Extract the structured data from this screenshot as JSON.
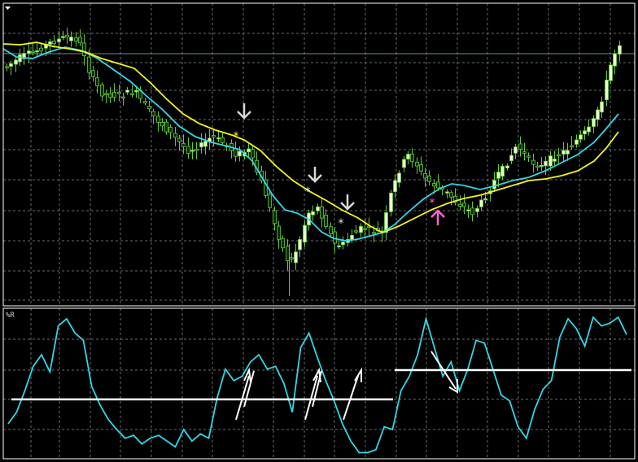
{
  "indicator_label": "%R",
  "colors": {
    "background": "#000000",
    "grid": "#6d6d6d",
    "frame": "#ffffff",
    "bull_candle_body": "#e8ffd0",
    "bear_candle_body": "#0a2a0a",
    "candle_wick": "#66cc33",
    "ma_fast": "#33d6e8",
    "ma_slow": "#f4f41a",
    "wpr_line": "#33d6e8",
    "level_line": "#ffffff",
    "arrow_down": "#d8d8d8",
    "arrow_up": "#ff66cc",
    "signal_star_yellow": "#f4f41a",
    "signal_star_white": "#e0e0e0",
    "signal_star_pink": "#ff66cc"
  },
  "chart_data": [
    {
      "type": "candlestick",
      "title": "",
      "overlays": [
        {
          "kind": "moving-average",
          "color": "#33d6e8"
        },
        {
          "kind": "moving-average",
          "color": "#f4f41a"
        }
      ],
      "signals": [
        {
          "kind": "sell-arrow",
          "bar": 47
        },
        {
          "kind": "sell-arrow",
          "bar": 61
        },
        {
          "kind": "sell-arrow",
          "bar": 68
        },
        {
          "kind": "buy-arrow",
          "bar": 87
        }
      ],
      "grid": true
    },
    {
      "type": "line",
      "title": "%R",
      "series": [
        {
          "values": [
            -78,
            -70,
            -55,
            -38,
            -30,
            -42,
            -10,
            -5,
            -15,
            -20,
            -52,
            -65,
            -75,
            -82,
            -88,
            -86,
            -92,
            -88,
            -86,
            -90,
            -94,
            -82,
            -90,
            -85,
            -88,
            -60,
            -40,
            -48,
            -45,
            -35,
            -30,
            -40,
            -38,
            -50,
            -70,
            -25,
            -15,
            -32,
            -48,
            -62,
            -78,
            -90,
            -98,
            -98,
            -96,
            -80,
            -82,
            -55,
            -45,
            -30,
            -5,
            -25,
            -45,
            -35,
            -55,
            -40,
            -20,
            -22,
            -40,
            -58,
            -62,
            -80,
            -88,
            -68,
            -54,
            -48,
            -18,
            -5,
            -12,
            -24,
            -4,
            -10,
            -8,
            -4,
            -16
          ]
        }
      ],
      "levels": [
        -50,
        -30
      ],
      "grid": true
    }
  ]
}
